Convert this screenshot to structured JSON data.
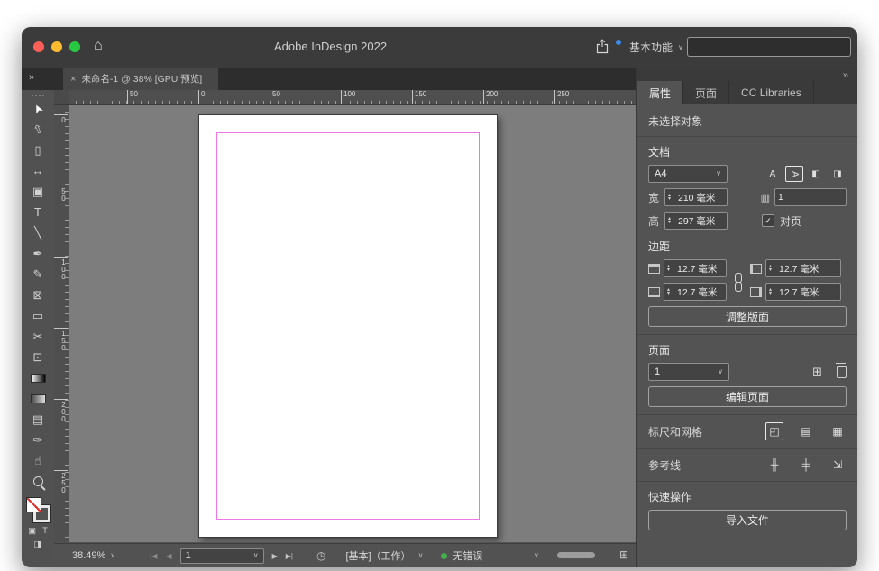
{
  "colors": {
    "accent": "#3f8ae8",
    "margin_guide": "#f075e8",
    "status_green": "#43b14b",
    "traffic_red": "#ff5f57",
    "traffic_yellow": "#febc2e",
    "traffic_green": "#28c840"
  },
  "titlebar": {
    "title": "Adobe InDesign 2022",
    "workspace": "基本功能",
    "search_value": ""
  },
  "tabstrip": {
    "doc_tab": "未命名-1 @ 38% [GPU 预览]"
  },
  "icons": {
    "chevron_down": "∨",
    "chevrons": "»",
    "close": "×",
    "home": "⌂",
    "stepper_up": "▴",
    "stepper_down": "▾",
    "first_page": "|◀",
    "prev_page": "◀",
    "next_page": "▶",
    "last_page": "▶|",
    "clock": "◷",
    "grid": "⊞",
    "add_page": "⊞",
    "container": "▣",
    "text_tool_small": "T",
    "screen_mode": "◨",
    "orientation_a": "A",
    "binding_ltr": "◧",
    "binding_rtl": "◨",
    "page_count": "▥",
    "check": "✓",
    "ruler": "◰",
    "baseline_grid": "▤",
    "doc_grid": "▦",
    "column_guides": "╫",
    "ruler_guides": "╪",
    "smart_guides": "⇲"
  },
  "toolbar": {
    "tools": [
      {
        "name": "selection",
        "glyph": "➤"
      },
      {
        "name": "direct-selection",
        "glyph": "⇧"
      },
      {
        "name": "page",
        "glyph": "▯"
      },
      {
        "name": "gap",
        "glyph": "↔"
      },
      {
        "name": "content-collector",
        "glyph": "▣"
      },
      {
        "name": "type",
        "glyph": "T"
      },
      {
        "name": "line",
        "glyph": "╲"
      },
      {
        "name": "pen",
        "glyph": "✒"
      },
      {
        "name": "pencil",
        "glyph": "✎"
      },
      {
        "name": "frame",
        "glyph": "⊠"
      },
      {
        "name": "rectangle",
        "glyph": "▭"
      },
      {
        "name": "scissors",
        "glyph": "✂"
      },
      {
        "name": "free-transform",
        "glyph": "⊡"
      },
      {
        "name": "gradient",
        "glyph": ""
      },
      {
        "name": "gradient-feather",
        "glyph": ""
      },
      {
        "name": "note",
        "glyph": "▤"
      },
      {
        "name": "eyedropper",
        "glyph": "✑"
      },
      {
        "name": "hand",
        "glyph": "☝"
      },
      {
        "name": "zoom",
        "glyph": ""
      }
    ]
  },
  "rulers": {
    "h": [
      "50",
      "0",
      "50",
      "100",
      "150",
      "200",
      "250"
    ],
    "v": [
      "0",
      "50",
      "100",
      "150",
      "200",
      "250"
    ]
  },
  "properties": {
    "tabs": [
      "属性",
      "页面",
      "CC Libraries"
    ],
    "no_selection": "未选择对象",
    "document": {
      "header": "文档",
      "page_size": "A4",
      "width_label": "宽",
      "width": "210 毫米",
      "height_label": "高",
      "height": "297 毫米",
      "page_count": "1",
      "facing_pages": "对页"
    },
    "margins": {
      "header": "边距",
      "top": "12.7 毫米",
      "bottom": "12.7 毫米",
      "inside": "12.7 毫米",
      "outside": "12.7 毫米",
      "adjust_layout": "调整版面"
    },
    "pages": {
      "header": "页面",
      "current": "1",
      "edit_page": "编辑页面"
    },
    "rulers_grids": {
      "header": "标尺和网格"
    },
    "guides": {
      "header": "参考线"
    },
    "quick_actions": {
      "header": "快速操作",
      "import_file": "导入文件"
    }
  },
  "statusbar": {
    "zoom": "38.49%",
    "page": "1",
    "preflight_profile": "[基本]（工作）",
    "no_errors": "无错误"
  }
}
